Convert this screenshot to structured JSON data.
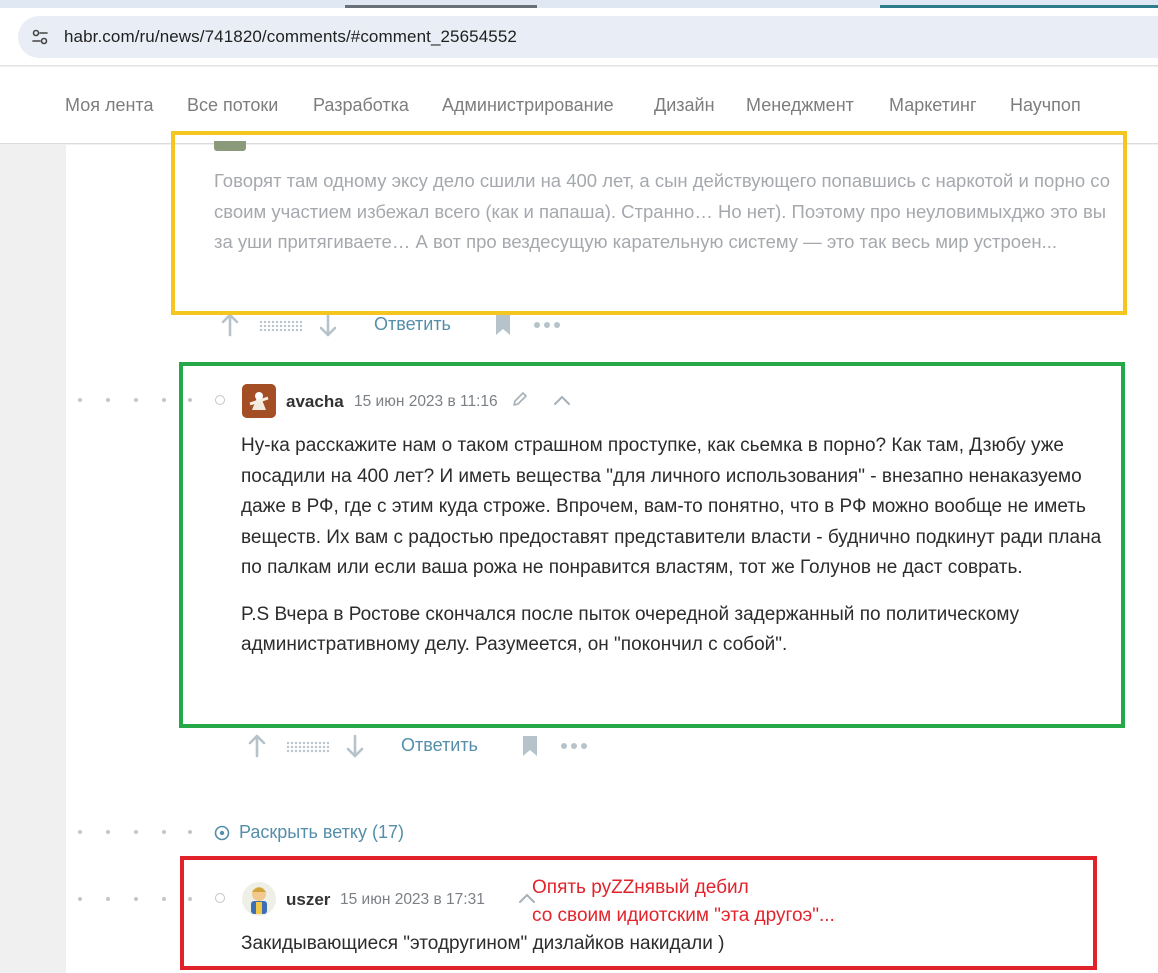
{
  "browser": {
    "url": "habr.com/ru/news/741820/comments/#comment_25654552",
    "site_info_icon": "tune-icon"
  },
  "nav": {
    "items": [
      {
        "label": "Моя лента"
      },
      {
        "label": "Все потоки"
      },
      {
        "label": "Разработка"
      },
      {
        "label": "Администрирование"
      },
      {
        "label": "Дизайн"
      },
      {
        "label": "Менеджмент"
      },
      {
        "label": "Маркетинг"
      },
      {
        "label": "Научпоп"
      }
    ]
  },
  "comments": {
    "c1": {
      "text": "Говорят там одному эксу дело сшили на 400 лет, а сын действующего попавшись с наркотой и порно со своим участием избежал всего (как и папаша). Странно… Но нет). Поэтому про неуловимыхджо это вы за уши притягиваете… А вот про вездесущую карательную систему — это так весь мир устроен...",
      "reply_label": "Ответить"
    },
    "c2": {
      "username": "avacha",
      "timestamp": "15 июн 2023 в 11:16",
      "paragraphs": [
        "Ну-ка расскажите нам о таком страшном проступке, как сьемка в порно? Как там, Дзюбу уже посадили на 400 лет? И иметь вещества \"для личного использования\" - внезапно ненаказуемо даже в РФ, где с этим куда строже. Впрочем, вам-то понятно, что в РФ можно вообще не иметь веществ. Их вам с радостью предоставят представители власти - буднично подкинут ради плана по палкам или если ваша рожа не понравится властям, тот же Голунов не даст соврать.",
        "P.S Вчера в Ростове скончался после пыток очередной задержанный по политическому административному делу. Разумеется, он \"покончил с собой\"."
      ],
      "reply_label": "Ответить"
    },
    "expand_thread": "Раскрыть ветку (17)",
    "c3": {
      "username": "uszer",
      "timestamp": "15 июн 2023 в 17:31",
      "text": "Закидывающиеся \"этодругином\" дизлайков накидали )"
    }
  },
  "annotation": {
    "line1": "Опять руZZнявый дебил",
    "line2": "со своим идиотским \"эта другоэ\"...",
    "colors": {
      "yellow": "#f4c61f",
      "green": "#25a848",
      "red": "#e0232b"
    }
  },
  "colors": {
    "link": "#548eaa",
    "text": "#2c2c2c",
    "muted": "#7c8085"
  }
}
